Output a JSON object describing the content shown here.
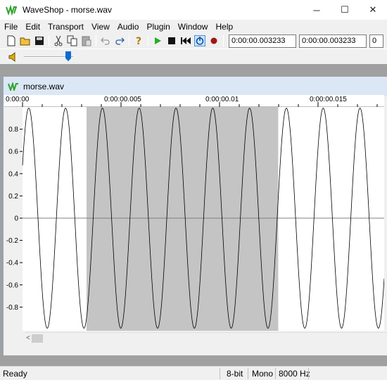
{
  "window": {
    "title": "WaveShop - morse.wav",
    "controls": {
      "minimize": "─",
      "maximize": "☐",
      "close": "✕"
    }
  },
  "menu": [
    "File",
    "Edit",
    "Transport",
    "View",
    "Audio",
    "Plugin",
    "Window",
    "Help"
  ],
  "toolbar": {
    "icons": [
      "new-file-icon",
      "open-folder-icon",
      "save-icon",
      "cut-icon",
      "copy-icon",
      "paste-icon",
      "undo-icon",
      "redo-icon",
      "help-icon",
      "play-icon",
      "stop-icon",
      "rewind-icon",
      "loop-icon",
      "record-icon"
    ],
    "selection_start": "0:00:00.003233",
    "selection_end": "0:00:00.003233",
    "selection_length": "0"
  },
  "volume": {
    "icon": "speaker-icon",
    "level": 0.9
  },
  "document": {
    "title": "morse.wav",
    "ruler_labels": [
      "0:00:00",
      "0:00:00.005",
      "0:00:00.01",
      "0:00:00.015"
    ],
    "amplitude_labels": [
      "0.8",
      "0.6",
      "0.4",
      "0.2",
      "0",
      "-0.2",
      "-0.4",
      "-0.6",
      "-0.8"
    ],
    "scroll_left": "<",
    "selection_fraction": [
      0.177,
      0.707
    ]
  },
  "status": {
    "text": "Ready",
    "bits": "8-bit",
    "channels": "Mono",
    "rate": "8000 Hz"
  }
}
